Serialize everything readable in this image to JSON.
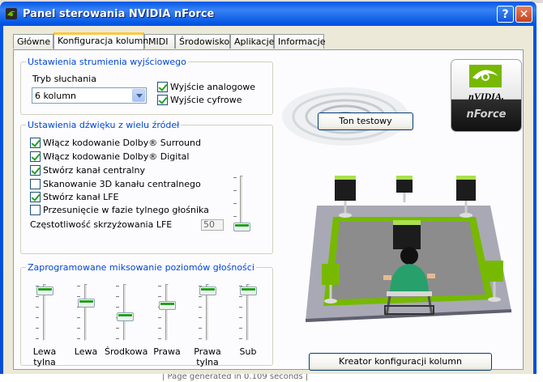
{
  "window": {
    "title": "Panel sterowania NVIDIA nForce",
    "help": "?",
    "close": "✕"
  },
  "tabs": [
    "Główne",
    "Konfiguracja kolumn",
    "MIDI",
    "Środowisko",
    "Aplikacje",
    "Informacje"
  ],
  "active_tab": "Konfiguracja kolumn",
  "output_stream": {
    "title": "Ustawienia strumienia wyjściowego",
    "listening_mode_label": "Tryb słuchania",
    "listening_mode_value": "6 kolumn",
    "analog_output": {
      "label": "Wyjście analogowe",
      "checked": true
    },
    "digital_output": {
      "label": "Wyjście cyfrowe",
      "checked": true
    }
  },
  "multi_source": {
    "title": "Ustawienia dźwięku z wielu źródeł",
    "options": [
      {
        "label": "Włącz kodowanie Dolby® Surround",
        "checked": true
      },
      {
        "label": "Włącz kodowanie Dolby® Digital",
        "checked": true
      },
      {
        "label": "Stwórz kanał centralny",
        "checked": true
      },
      {
        "label": "Skanowanie 3D kanału centralnego",
        "checked": false
      },
      {
        "label": "Stwórz kanał LFE",
        "checked": true
      },
      {
        "label": "Przesunięcie w fazie tylnego głośnika",
        "checked": false
      }
    ],
    "lfe_crossover_label": "Częstotliwość skrzyżowania LFE",
    "lfe_crossover_value": "50"
  },
  "level_mixing": {
    "title": "Zaprogramowane miksowanie poziomów głośności",
    "channels": [
      {
        "label": "Lewa tylna",
        "level": 0.95
      },
      {
        "label": "Lewa",
        "level": 0.7
      },
      {
        "label": "Środkowa",
        "level": 0.4
      },
      {
        "label": "Prawa",
        "level": 0.65
      },
      {
        "label": "Prawa tylna",
        "level": 0.95
      },
      {
        "label": "Sub",
        "level": 0.95
      }
    ]
  },
  "buttons": {
    "test_tone": "Ton testowy",
    "wizard": "Kreator konfiguracji kolumn"
  },
  "logo": {
    "line1": "nVIDIA.",
    "line2": "nForce"
  },
  "colors": {
    "accent_green": "#76b900",
    "group_title": "#0046d5",
    "titlebar": "#0054e3"
  },
  "background": {
    "footer": "| Page generated in 0.109 seconds |"
  }
}
